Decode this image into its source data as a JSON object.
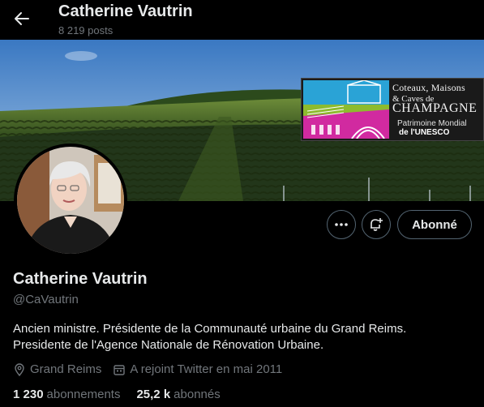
{
  "header": {
    "title": "Catherine Vautrin",
    "posts_count": "8 219 posts"
  },
  "banner": {
    "logo": {
      "line1": "Coteaux, Maisons",
      "line2": "& Caves de",
      "line3": "CHAMPAGNE",
      "line4": "Patrimoine Mondial",
      "line5": "de l'UNESCO"
    }
  },
  "profile": {
    "display_name": "Catherine Vautrin",
    "handle": "@CaVautrin",
    "bio_line1": "Ancien ministre. Présidente de la Communauté urbaine du Grand Reims.",
    "bio_line2": "Presidente de l'Agence Nationale de Rénovation Urbaine.",
    "location": "Grand Reims",
    "joined": "A rejoint Twitter en mai 2011",
    "following_count": "1 230",
    "following_label": "abonnements",
    "followers_count": "25,2 k",
    "followers_label": "abonnés"
  },
  "actions": {
    "follow_label": "Abonné",
    "more_icon": "more-icon",
    "notify_icon": "bell-plus-icon"
  },
  "colors": {
    "background": "#000000",
    "text_primary": "#e7e9ea",
    "text_secondary": "#71767b",
    "border": "#536471"
  }
}
